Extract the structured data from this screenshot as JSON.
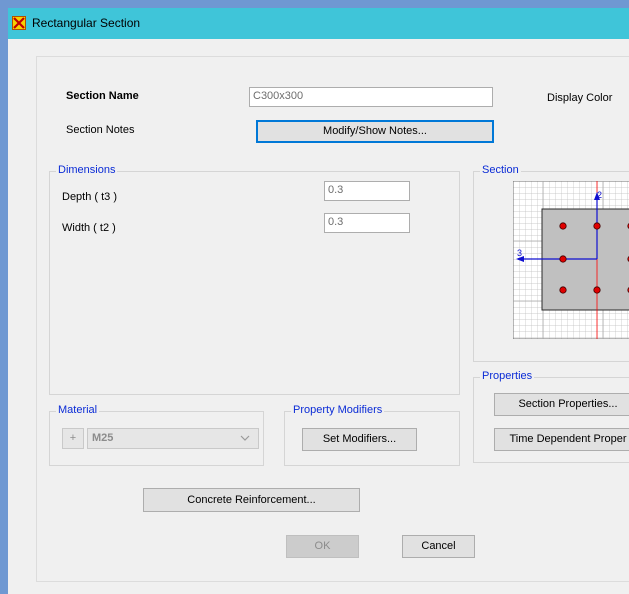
{
  "window": {
    "title": "Rectangular Section"
  },
  "section_name": {
    "label": "Section Name",
    "value": "C300x300"
  },
  "display_color": {
    "label": "Display Color"
  },
  "section_notes": {
    "label": "Section Notes",
    "button": "Modify/Show Notes..."
  },
  "dimensions": {
    "legend": "Dimensions",
    "depth_label": "Depth  ( t3 )",
    "depth_value": "0.3",
    "width_label": "Width  ( t2 )",
    "width_value": "0.3"
  },
  "section_preview": {
    "legend": "Section",
    "axis2": "2",
    "axis3": "3",
    "colors": {
      "grid": "#bdbdbd",
      "concrete": "#c0c0c0",
      "rebar": "#e00000",
      "axis": "#1010d0"
    }
  },
  "properties": {
    "legend": "Properties",
    "section_properties_button": "Section Properties...",
    "time_dependent_button": "Time Dependent Proper"
  },
  "material": {
    "legend": "Material",
    "plus": "+",
    "value": "M25"
  },
  "property_modifiers": {
    "legend": "Property Modifiers",
    "button": "Set Modifiers..."
  },
  "concrete_reinforcement": {
    "button": "Concrete Reinforcement..."
  },
  "buttons": {
    "ok": "OK",
    "cancel": "Cancel"
  }
}
